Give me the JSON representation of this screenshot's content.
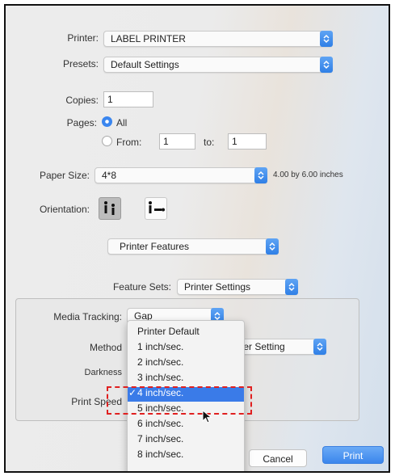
{
  "dialog": {
    "printer": {
      "label": "Printer:",
      "value": "LABEL PRINTER"
    },
    "presets": {
      "label": "Presets:",
      "value": "Default Settings"
    },
    "copies": {
      "label": "Copies:",
      "value": "1"
    },
    "pages": {
      "label": "Pages:",
      "all_label": "All",
      "from_label": "From:",
      "from_value": "1",
      "to_label": "to:",
      "to_value": "1"
    },
    "paper_size": {
      "label": "Paper Size:",
      "value": "4*8",
      "dimensions": "4.00 by 6.00 inches"
    },
    "orientation": {
      "label": "Orientation:"
    },
    "section_popup": "Printer Features",
    "feature_sets": {
      "label": "Feature Sets:",
      "value": "Printer Settings"
    },
    "media_tracking": {
      "label": "Media Tracking:",
      "value": "Gap"
    },
    "method": {
      "label": "Method",
      "value": "ter Setting"
    },
    "darkness": {
      "label": "Darkness"
    },
    "print_speed": {
      "label": "Print Speed"
    },
    "buttons": {
      "cancel": "Cancel",
      "print": "Print"
    }
  },
  "speed_menu": {
    "items": [
      "Printer Default",
      "1 inch/sec.",
      "2 inch/sec.",
      "3 inch/sec.",
      "4 inch/sec.",
      "5 inch/sec.",
      "6 inch/sec.",
      "7 inch/sec.",
      "8 inch/sec."
    ],
    "selected_index": 4,
    "check_mark": "✓"
  },
  "colors": {
    "accent": "#3a7be8",
    "annotation": "#e02020"
  }
}
